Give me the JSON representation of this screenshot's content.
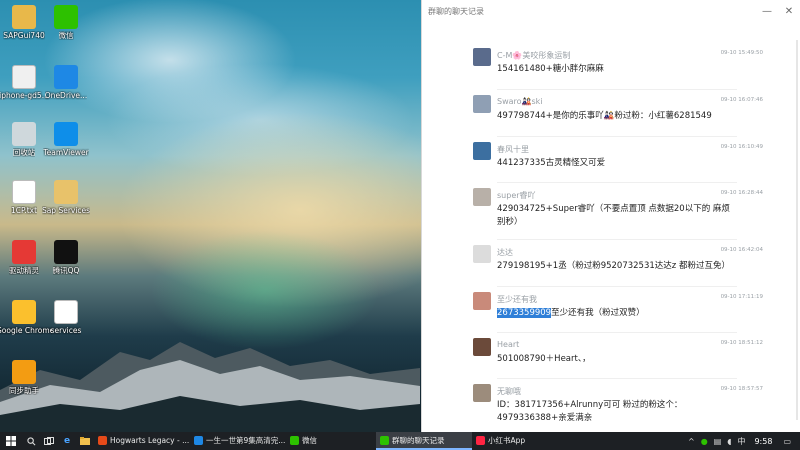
{
  "desktop": {
    "icons": [
      {
        "label": "SAPGui740",
        "icon": "folder-icon",
        "color": "#e8b84a"
      },
      {
        "label": "微信",
        "icon": "wechat-icon",
        "color": "#2dc100"
      },
      {
        "label": "iphone-gd5...",
        "icon": "document-icon",
        "color": "#f0f0f0"
      },
      {
        "label": "OneDrive...",
        "icon": "cloud-icon",
        "color": "#1e88e5"
      },
      {
        "label": "回收站",
        "icon": "recycle-bin-icon",
        "color": "#cfd8dc"
      },
      {
        "label": "TeamViewer",
        "icon": "teamviewer-icon",
        "color": "#0e8ee9"
      },
      {
        "label": "1CP.txt",
        "icon": "text-file-icon",
        "color": "#ffffff"
      },
      {
        "label": "Sap Services",
        "icon": "folder-icon",
        "color": "#e8c26a"
      },
      {
        "label": "驱动精灵",
        "icon": "driver-genius-icon",
        "color": "#e53935"
      },
      {
        "label": "腾讯QQ",
        "icon": "qq-penguin-icon",
        "color": "#111111"
      },
      {
        "label": "Google Chrome",
        "icon": "chrome-icon",
        "color": "#fbc02d"
      },
      {
        "label": "services",
        "icon": "document-icon",
        "color": "#ffffff"
      },
      {
        "label": "同步助手",
        "icon": "sync-assistant-icon",
        "color": "#f39c12"
      }
    ]
  },
  "chat": {
    "title": "群聊的聊天记录",
    "controls": {
      "minimize": "—",
      "close": "✕"
    },
    "messages": [
      {
        "name": "C-M🌸美咬彤象运制",
        "time": "09-10 15:49:50",
        "text": "154161480+糖小胖尔麻麻",
        "avatar": "#5a6b8c"
      },
      {
        "name": "Swaro🎎ski",
        "time": "09-10 16:07:46",
        "text": "497798744+是你的乐事吖🎎粉过粉：小红薯6281549",
        "avatar": "#8f9fb4"
      },
      {
        "name": "春风十里",
        "time": "09-10 16:10:49",
        "text": "441237335古灵精怪又可爱",
        "avatar": "#3c6fa0"
      },
      {
        "name": "super睿吖",
        "time": "09-10 16:28:44",
        "text": "429034725+Super睿吖（不要点置顶 点数据20以下的 麻烦别秒）",
        "avatar": "#b8b0a8"
      },
      {
        "name": "达达",
        "time": "09-10 16:42:04",
        "text": "279198195+1丞（粉过粉9520732531达达z 都粉过互免）",
        "avatar": "#dcdcdc"
      },
      {
        "name": "至少还有我",
        "time": "09-10 17:11:19",
        "text_highlight": "2673359909",
        "text_rest": "至少还有我（粉过双赞）",
        "avatar": "#c98a7a"
      },
      {
        "name": "Heart",
        "time": "09-10 18:51:12",
        "text": "501008790＋Heart、，",
        "avatar": "#6b4a3a"
      },
      {
        "name": "无聊哦",
        "time": "09-10 18:57:57",
        "text": "ID：381717356+Alrunny可可  粉过的粉这个：4979336388+亲爱满亲",
        "avatar": "#9c8c7c"
      }
    ]
  },
  "taskbar": {
    "apps": [
      {
        "label": "Hogwarts Legacy - ...",
        "color": "#e64a19",
        "active": false
      },
      {
        "label": "一生一世第9集高清完...",
        "color": "#1e88e5",
        "active": false
      },
      {
        "label": "微信",
        "color": "#2dc100",
        "active": false
      },
      {
        "label": "群聊的聊天记录",
        "color": "#2dc100",
        "active": true
      },
      {
        "label": "小红书App",
        "color": "#ff2442",
        "active": false
      }
    ],
    "clock": "9:58",
    "ime": "中"
  }
}
